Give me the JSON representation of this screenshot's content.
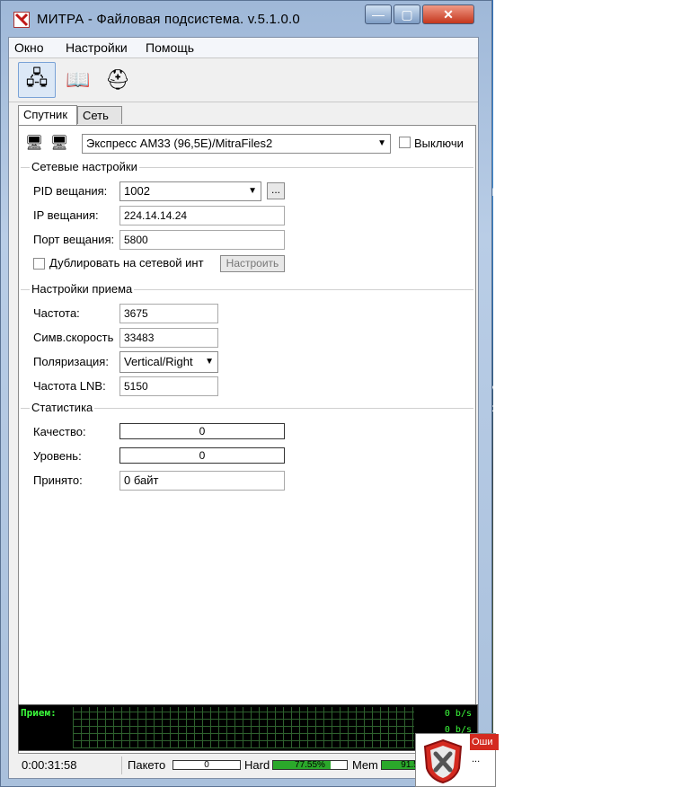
{
  "window": {
    "title": "МИТРА - Файловая подсистема. v.5.1.0.0",
    "min_glyph": "—",
    "max_glyph": "▢",
    "close_glyph": "✕"
  },
  "menu": [
    "Окно",
    "Настройки",
    "Помощь"
  ],
  "tabs": [
    "Спутник",
    "Сеть"
  ],
  "source": {
    "selected": "Экспресс АМ33 (96,5E)/MitraFiles2",
    "off_label": "Выключи"
  },
  "network": {
    "title": "Сетевые настройки",
    "pid_label": "PID вещания:",
    "pid_value": "1002",
    "pid_more": "...",
    "ip_label": "IP вещания:",
    "ip_value": "224.14.14.24",
    "port_label": "Порт вещания:",
    "port_value": "5800",
    "dup_label": "Дублировать на сетевой инт",
    "configure_label": "Настроить"
  },
  "reception": {
    "title": "Настройки приема",
    "freq_label": "Частота:",
    "freq_value": "3675",
    "symrate_label": "Симв.скорость",
    "symrate_value": "33483",
    "polar_label": "Поляризация:",
    "polar_value": "Vertical/Right",
    "lnb_label": "Частота LNB:",
    "lnb_value": "5150"
  },
  "stats": {
    "title": "Статистика",
    "quality_label": "Качество:",
    "quality_value": "0",
    "level_label": "Уровень:",
    "level_value": "0",
    "received_label": "Принято:",
    "received_value": "0 байт"
  },
  "graph": {
    "label": "Прием:",
    "rate1": "0 b/s",
    "rate2": "0 b/s"
  },
  "status": {
    "time": "0:00:31:58",
    "packets_label": "Пакето",
    "packets_value": "0",
    "hard_label": "Hard",
    "hard_value": "77.55%",
    "hard_fraction": 0.7755,
    "mem_label": "Mem",
    "mem_value": "91.5",
    "mem_fraction": 0.915
  },
  "error_popup": {
    "head": "Оши",
    "body": "..."
  },
  "colors": {
    "graph_text": "#3cff3c",
    "bar_fill": "#2ba82b",
    "close_red": "#c4361c"
  }
}
